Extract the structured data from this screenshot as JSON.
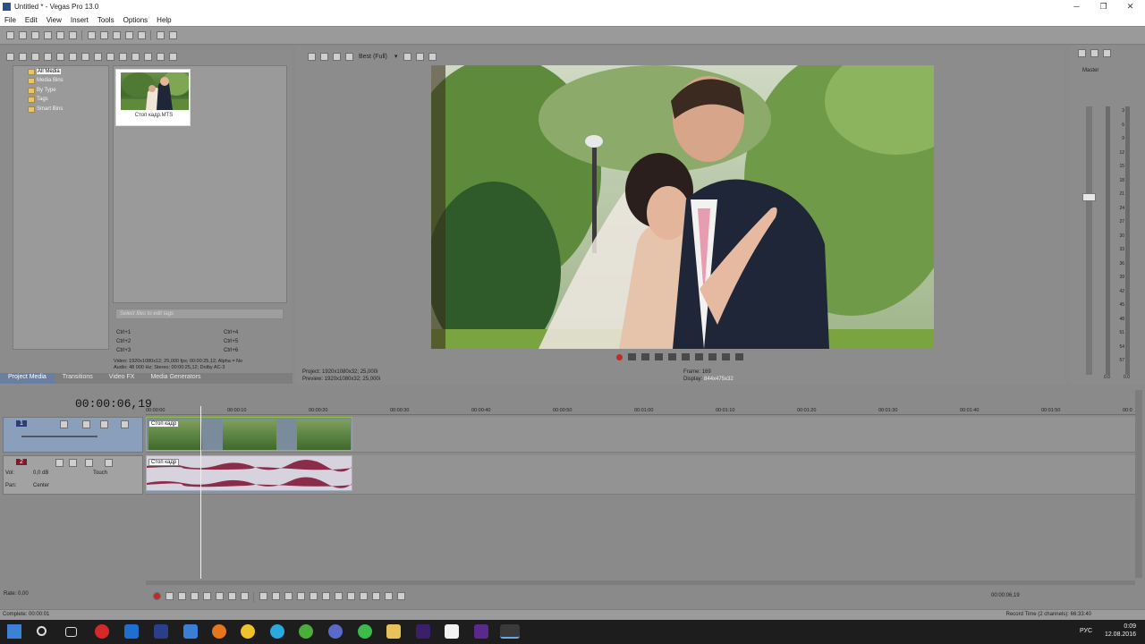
{
  "window": {
    "title": "Untitled * - Vegas Pro 13.0",
    "minimize": "─",
    "maximize": "❐",
    "close": "✕"
  },
  "menu": [
    "File",
    "Edit",
    "View",
    "Insert",
    "Tools",
    "Options",
    "Help"
  ],
  "explorer": {
    "tree": [
      "All Media",
      "Media Bins",
      "By Type",
      "Tags",
      "Smart Bins"
    ],
    "media_file": "Стоп кадр.MTS",
    "tags_placeholder": "Select files to edit tags",
    "shortcuts_left": [
      "Ctrl+1",
      "Ctrl+2",
      "Ctrl+3"
    ],
    "shortcuts_right": [
      "Ctrl+4",
      "Ctrl+5",
      "Ctrl+6"
    ],
    "info_line1": "Video: 1920x1080x12; 25,000 fps; 00:00:25,12; Alpha = No",
    "info_line2": "Audio: 48 000 Hz; Stereo; 00:00:25,12; Dolby AC-3"
  },
  "tabs": [
    "Project Media",
    "Transitions",
    "Video FX",
    "Media Generators"
  ],
  "preview": {
    "quality": "Best (Full)",
    "project_label": "Project:",
    "project_value": "1920x1080x32; 25,000i",
    "preview_label": "Preview:",
    "preview_value": "1920x1080x32; 25,000i",
    "frame_label": "Frame:",
    "frame_value": "169",
    "display_label": "Display:",
    "display_value": "844x475x32"
  },
  "master": {
    "label": "Master",
    "db_values": [
      "3",
      "6",
      "9",
      "12",
      "15",
      "18",
      "21",
      "24",
      "27",
      "30",
      "33",
      "36",
      "39",
      "42",
      "45",
      "48",
      "51",
      "54",
      "57"
    ],
    "bottom_left": "0.0",
    "bottom_right": "0.0"
  },
  "timeline": {
    "timecode": "00:00:06,19",
    "ruler": [
      "00:00:00",
      "00:00:10",
      "00:00:20",
      "00:00:30",
      "00:00:40",
      "00:00:50",
      "00:01:00",
      "00:01:10",
      "00:01:20",
      "00:01:30",
      "00:01:40",
      "00:01:50",
      "00:0"
    ],
    "video_track_num": "1",
    "audio_track_num": "2",
    "vol_label": "Vol:",
    "vol_value": "0,0 dB",
    "pan_label": "Pan:",
    "pan_value": "Center",
    "touch": "Touch",
    "clip_label": "Стоп кадр"
  },
  "rate": "Rate: 0,00",
  "bottom_timecode": "00:00:06,19",
  "status": {
    "left": "Complete: 00:00:01",
    "right": "Record Time (2 channels): 66:33:40"
  },
  "taskbar": {
    "lang": "РУС",
    "time": "0:09",
    "date": "12.08.2016"
  }
}
